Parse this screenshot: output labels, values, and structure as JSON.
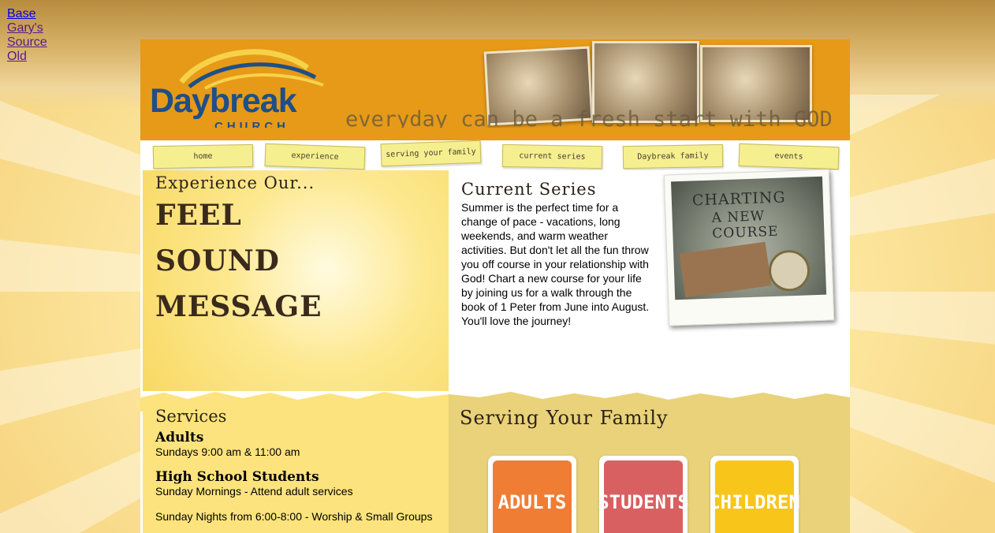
{
  "top_links": [
    "Base",
    "Gary's",
    "Source",
    "Old"
  ],
  "header": {
    "logo_word": "Daybreak",
    "logo_sub": "CHURCH",
    "tagline": "everyday can be a fresh start with GOD"
  },
  "nav": {
    "items": [
      "home",
      "experience",
      "serving your family",
      "current series",
      "Daybreak family",
      "events"
    ]
  },
  "experience": {
    "heading": "Experience Our...",
    "items": [
      "FEEL",
      "SOUND",
      "MESSAGE"
    ]
  },
  "current_series": {
    "heading": "Current Series",
    "body": "Summer is the perfect time for a change of pace - vacations, long weekends, and warm weather activities. But don't let all the fun throw you off course in your relationship with God! Chart a new course for your life by joining us for a walk through the book of 1 Peter from June into August. You'll love the journey!",
    "image_caption_line1": "CHARTING",
    "image_caption_line2": "A NEW COURSE"
  },
  "services": {
    "heading": "Services",
    "groups": [
      {
        "title": "Adults",
        "lines": [
          "Sundays 9:00 am & 11:00 am"
        ]
      },
      {
        "title": "High School Students",
        "lines": [
          "Sunday Mornings - Attend adult services"
        ]
      },
      {
        "title": "",
        "lines": [
          "Sunday Nights from 6:00-8:00 - Worship & Small Groups"
        ]
      }
    ]
  },
  "family": {
    "heading": "Serving Your Family",
    "tiles": [
      "ADULTS",
      "STUDENTS",
      "CHILDREN"
    ]
  },
  "colors": {
    "header_orange": "#e69a18",
    "logo_blue": "#1e4f86",
    "tab_yellow": "#f5ef8f",
    "adults_orange": "#ef7d34",
    "students_red": "#d86060",
    "children_yellow": "#f8c51a"
  }
}
